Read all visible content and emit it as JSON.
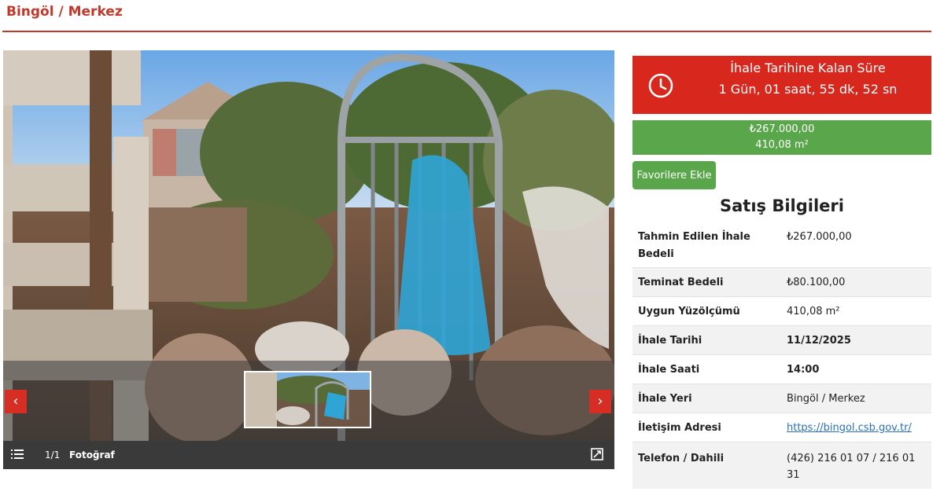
{
  "header": {
    "title": "Bingöl / Merkez"
  },
  "gallery": {
    "counter": "1/1",
    "label": "Fotoğraf",
    "prev_arrow": "‹",
    "next_arrow": "›",
    "icons": {
      "list": "list-icon",
      "expand": "expand-icon"
    }
  },
  "countdown": {
    "title": "İhale Tarihine Kalan Süre",
    "value": "1 Gün, 01 saat, 55 dk, 52 sn",
    "color": "#d8271c",
    "icon": "clock-icon"
  },
  "price_box": {
    "price": "₺267.000,00",
    "area": "410,08 m²",
    "color": "#5aa64a"
  },
  "favorite_button": {
    "label": "Favorilere Ekle"
  },
  "sale_info": {
    "title": "Satış Bilgileri",
    "rows": [
      {
        "label": "Tahmin Edilen İhale Bedeli",
        "value": "₺267.000,00"
      },
      {
        "label": "Teminat Bedeli",
        "value": "₺80.100,00"
      },
      {
        "label": "Uygun Yüzölçümü",
        "value": "410,08 m²"
      },
      {
        "label": "İhale Tarihi",
        "value": "11/12/2025"
      },
      {
        "label": "İhale Saati",
        "value": "14:00"
      },
      {
        "label": "İhale Yeri",
        "value": "Bingöl / Merkez"
      },
      {
        "label": "İletişim Adresi",
        "value": "https://bingol.csb.gov.tr/"
      },
      {
        "label": "Telefon / Dahili",
        "value": "(426) 216 01 07 / 216 01 31"
      }
    ]
  }
}
